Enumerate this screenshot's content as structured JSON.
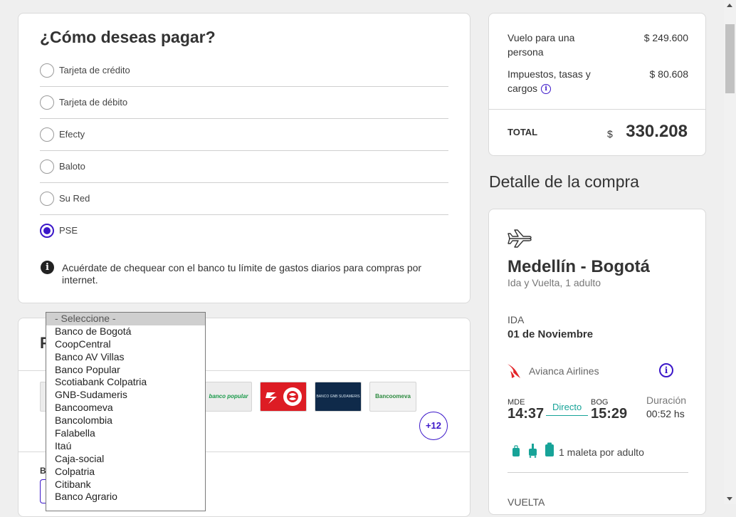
{
  "payment": {
    "title": "¿Cómo deseas pagar?",
    "options": [
      {
        "label": "Tarjeta de crédito",
        "selected": false
      },
      {
        "label": "Tarjeta de débito",
        "selected": false
      },
      {
        "label": "Efecty",
        "selected": false
      },
      {
        "label": "Baloto",
        "selected": false
      },
      {
        "label": "Su Red",
        "selected": false
      },
      {
        "label": "PSE",
        "selected": true
      }
    ],
    "notice": "Acuérdate de chequear con el banco tu límite de gastos diarios para compras por internet."
  },
  "bank_section": {
    "title_initial": "P",
    "label_initial": "B",
    "logos": {
      "popular": "banco popular",
      "gnb": "BANCO GNB SUDAMERIS",
      "bancoomeva": "Bancoomeva"
    },
    "more_button": "+12"
  },
  "bank_dropdown": {
    "options": [
      "- Seleccione -",
      "Banco de Bogotá",
      "CoopCentral",
      "Banco AV Villas",
      "Banco Popular",
      "Scotiabank Colpatria",
      "GNB-Sudameris",
      "Bancoomeva",
      "Bancolombia",
      "Falabella",
      "Itaú",
      "Caja-social",
      "Colpatria",
      "Citibank",
      "Banco Agrario"
    ],
    "selected_index": 0
  },
  "summary": {
    "flight_label": "Vuelo para una persona",
    "flight_value": "$ 249.600",
    "taxes_label": "Impuestos, tasas y cargos",
    "taxes_value": "$ 80.608",
    "total_label": "TOTAL",
    "total_currency": "$",
    "total_value": "330.208"
  },
  "detail": {
    "heading": "Detalle de la compra",
    "route": "Medellín - Bogotá",
    "route_sub": "Ida y Vuelta, 1 adulto",
    "leg_label": "IDA",
    "leg_date": "01 de Noviembre",
    "airline": "Avianca Airlines",
    "origin_code": "MDE",
    "origin_time": "14:37",
    "direct": "Directo",
    "dest_code": "BOG",
    "dest_time": "15:29",
    "duration_label": "Duración",
    "duration_value": "00:52 hs",
    "baggage": "1 maleta por adulto",
    "return_label": "VUELTA"
  },
  "colors": {
    "accent": "#3b17c9",
    "teal": "#17a398",
    "avianca_red": "#e3262a"
  }
}
